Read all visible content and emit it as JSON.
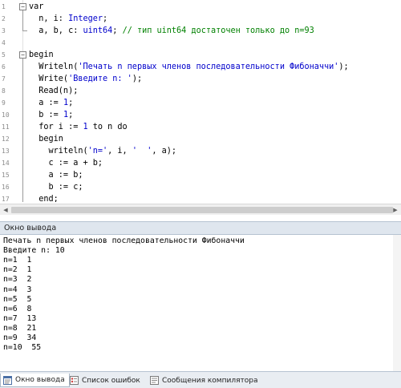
{
  "editor": {
    "line_numbers": [
      "1",
      "2",
      "3",
      "4",
      "5",
      "6",
      "7",
      "8",
      "9",
      "10",
      "11",
      "12",
      "13",
      "14",
      "15",
      "16",
      "17",
      "18"
    ],
    "lines": [
      [
        {
          "t": "var",
          "c": "kw"
        }
      ],
      [
        {
          "t": "  n, i: ",
          "c": "kw"
        },
        {
          "t": "Integer",
          "c": "ty"
        },
        {
          "t": ";",
          "c": "kw"
        }
      ],
      [
        {
          "t": "  a, b, c: ",
          "c": "kw"
        },
        {
          "t": "uint64",
          "c": "ty"
        },
        {
          "t": "; ",
          "c": "kw"
        },
        {
          "t": "// тип uint64 достаточен только до n=93",
          "c": "cmt"
        }
      ],
      [],
      [
        {
          "t": "begin",
          "c": "kw"
        }
      ],
      [
        {
          "t": "  Writeln(",
          "c": "kw"
        },
        {
          "t": "'Печать n первых членов последовательности Фибоначчи'",
          "c": "str"
        },
        {
          "t": ");",
          "c": "kw"
        }
      ],
      [
        {
          "t": "  Write(",
          "c": "kw"
        },
        {
          "t": "'Введите n: '",
          "c": "str"
        },
        {
          "t": ");",
          "c": "kw"
        }
      ],
      [
        {
          "t": "  Read(n);",
          "c": "kw"
        }
      ],
      [
        {
          "t": "  a := ",
          "c": "kw"
        },
        {
          "t": "1",
          "c": "num"
        },
        {
          "t": ";",
          "c": "kw"
        }
      ],
      [
        {
          "t": "  b := ",
          "c": "kw"
        },
        {
          "t": "1",
          "c": "num"
        },
        {
          "t": ";",
          "c": "kw"
        }
      ],
      [
        {
          "t": "  for i := ",
          "c": "kw"
        },
        {
          "t": "1",
          "c": "num"
        },
        {
          "t": " to n do",
          "c": "kw"
        }
      ],
      [
        {
          "t": "  begin",
          "c": "kw"
        }
      ],
      [
        {
          "t": "    writeln(",
          "c": "kw"
        },
        {
          "t": "'n='",
          "c": "str"
        },
        {
          "t": ", i, ",
          "c": "kw"
        },
        {
          "t": "'  '",
          "c": "str"
        },
        {
          "t": ", a);",
          "c": "kw"
        }
      ],
      [
        {
          "t": "    c := a + b;",
          "c": "kw"
        }
      ],
      [
        {
          "t": "    a := b;",
          "c": "kw"
        }
      ],
      [
        {
          "t": "    b := c;",
          "c": "kw"
        }
      ],
      [
        {
          "t": "  end;",
          "c": "kw"
        }
      ],
      [
        {
          "t": "end.",
          "c": "kw"
        }
      ]
    ]
  },
  "output": {
    "title": "Окно вывода",
    "lines": [
      "Печать n первых членов последовательности Фибоначчи",
      "Введите n: 10",
      "n=1  1",
      "n=2  1",
      "n=3  2",
      "n=4  3",
      "n=5  5",
      "n=6  8",
      "n=7  13",
      "n=8  21",
      "n=9  34",
      "n=10  55"
    ]
  },
  "tabs": [
    {
      "label": "Окно вывода",
      "icon": "output-window-icon",
      "active": true
    },
    {
      "label": "Список ошибок",
      "icon": "error-list-icon",
      "active": false
    },
    {
      "label": "Сообщения компилятора",
      "icon": "compiler-messages-icon",
      "active": false
    }
  ],
  "colors": {
    "type": "#0000cc",
    "string": "#0000cc",
    "number": "#0000cc",
    "comment": "#008000",
    "panel_header": "#dfe6ee"
  }
}
